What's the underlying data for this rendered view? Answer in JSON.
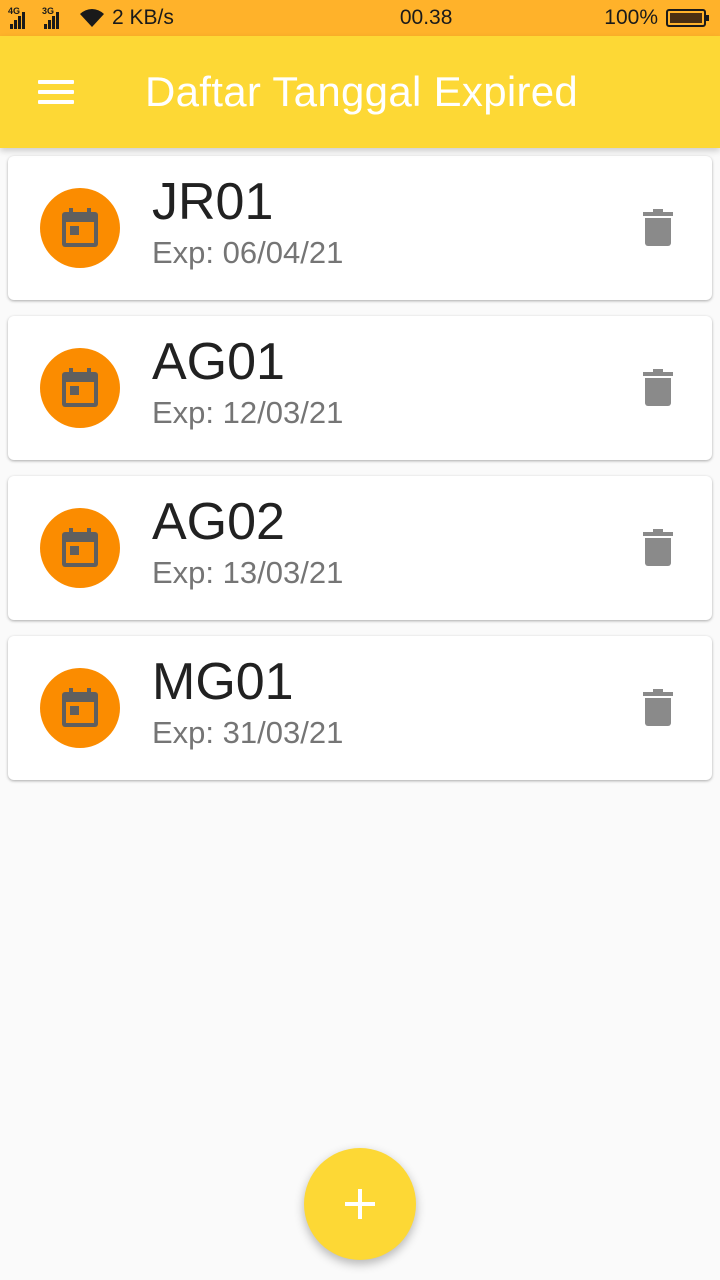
{
  "status_bar": {
    "net1": "4G",
    "net2": "3G",
    "speed": "2 KB/s",
    "time": "00.38",
    "battery": "100%"
  },
  "app_bar": {
    "title": "Daftar Tanggal Expired",
    "menu_icon": "hamburger-menu-icon"
  },
  "items": [
    {
      "code": "JR01",
      "exp": "Exp: 06/04/21"
    },
    {
      "code": "AG01",
      "exp": "Exp: 12/03/21"
    },
    {
      "code": "AG02",
      "exp": "Exp: 13/03/21"
    },
    {
      "code": "MG01",
      "exp": "Exp: 31/03/21"
    }
  ],
  "colors": {
    "status_bar": "#ffb22a",
    "app_bar": "#fdd835",
    "avatar": "#fb8c00",
    "calendar_icon": "#5f5f5f",
    "delete_icon": "#8a8a8a"
  },
  "fab": {
    "icon": "plus-icon"
  }
}
